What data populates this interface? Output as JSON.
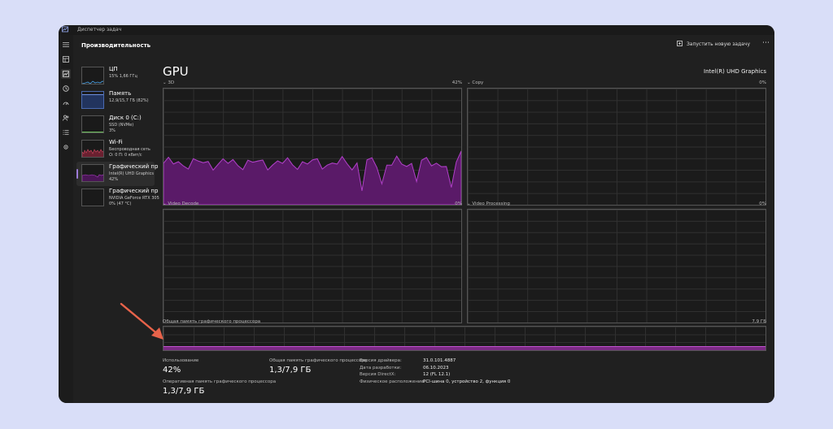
{
  "window": {
    "title": "Диспетчер задач"
  },
  "header": {
    "section": "Производительность",
    "new_task": "Запустить новую задачу",
    "more": "⋯"
  },
  "sidebar": {
    "items": [
      {
        "name": "ЦП",
        "line1": "15% 1,66 ГГц",
        "line2": ""
      },
      {
        "name": "Память",
        "line1": "12,9/15,7 ГБ (82%)",
        "line2": ""
      },
      {
        "name": "Диск 0 (C:)",
        "line1": "SSD (NVMe)",
        "line2": "3%"
      },
      {
        "name": "Wi-Fi",
        "line1": "Беспроводная сеть",
        "line2": "О: 0 П: 0 кбит/с"
      },
      {
        "name": "Графический пр",
        "line1": "Intel(R) UHD Graphics",
        "line2": "42%"
      },
      {
        "name": "Графический пр",
        "line1": "NVIDIA GeForce RTX 305",
        "line2": "0% (47 °C)"
      }
    ]
  },
  "main": {
    "title": "GPU",
    "gpu_name": "Intel(R) UHD Graphics",
    "engines": [
      {
        "label": "3D",
        "percent": "42%",
        "level": 0.42
      },
      {
        "label": "Copy",
        "percent": "0%",
        "level": 0
      },
      {
        "label": "Video Decode",
        "percent": "0%",
        "level": 0
      },
      {
        "label": "Video Processing",
        "percent": "0%",
        "level": 0
      }
    ],
    "shared_memory": {
      "label": "Общая память графического процессора",
      "max": "7,9 ГБ",
      "used_fraction": 0.16
    },
    "stats": {
      "usage_label": "Использование",
      "usage_value": "42%",
      "shared_label": "Общая память графического процессора",
      "shared_value": "1,3/7,9 ГБ",
      "gpu_mem_label": "Оперативная память графического процессора",
      "gpu_mem_value": "1,3/7,9 ГБ"
    },
    "properties": [
      {
        "key": "Версия драйвера:",
        "value": "31.0.101.4887"
      },
      {
        "key": "Дата разработки:",
        "value": "06.10.2023"
      },
      {
        "key": "Версия DirectX:",
        "value": "12 (FL 12.1)"
      },
      {
        "key": "Физическое расположение:",
        "value": "PCI-шина 0, устройство 2, функция 0"
      }
    ]
  },
  "colors": {
    "accent": "#9d7bd8",
    "graph_fill": "#5a1a68",
    "graph_line": "#b040c8",
    "annotation": "#e8634a"
  }
}
